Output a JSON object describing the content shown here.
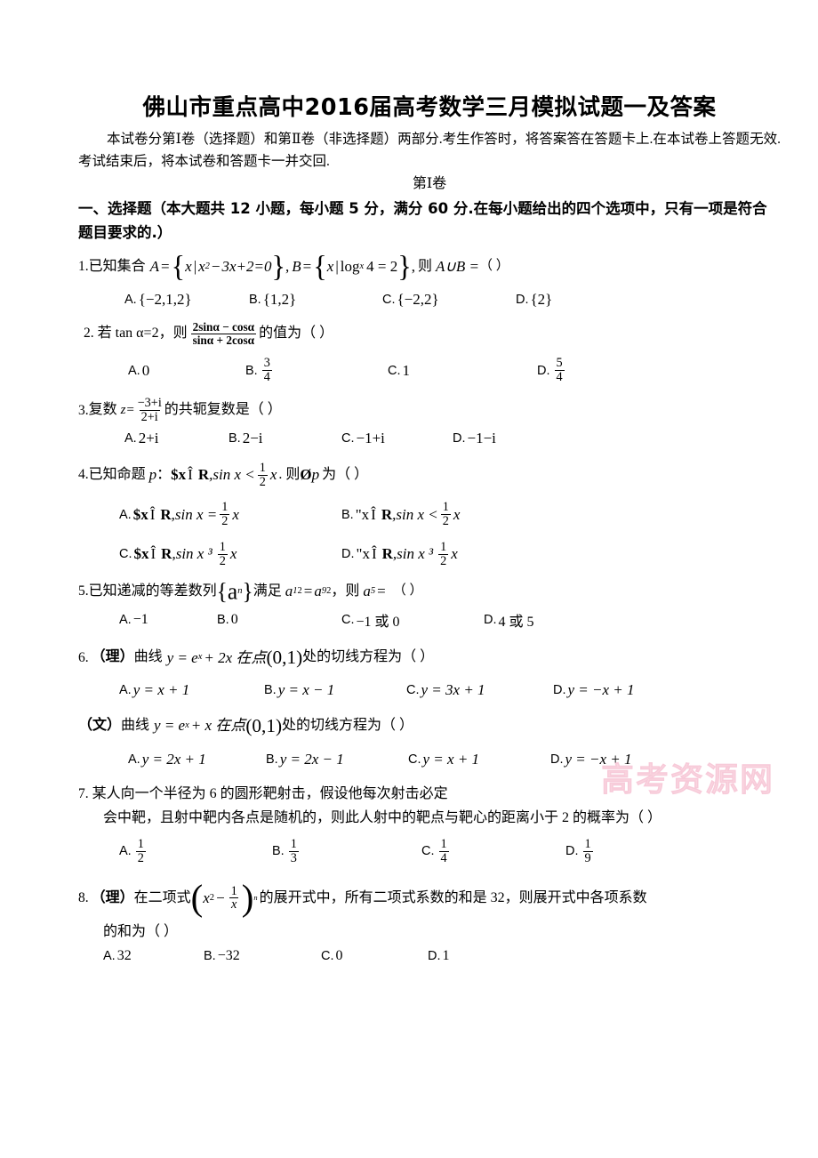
{
  "document": {
    "title": "佛山市重点高中2016届高考数学三月模拟试题一及答案",
    "intro": "本试卷分第Ⅰ卷（选择题）和第Ⅱ卷（非选择题）两部分.考生作答时，将答案答在答题卡上.在本试卷上答题无效.考试结束后，将本试卷和答题卡一并交回.",
    "volume_header": "第Ⅰ卷",
    "section_heading": "一、选择题（本大题共 12 小题，每小题 5 分，满分 60 分.在每小题给出的四个选项中，只有一项是符合题目要求的.）",
    "watermark": "高考资源网"
  },
  "questions": [
    {
      "number": "1.",
      "stem_prefix": "已知集合",
      "A_label": "A",
      "A_set_var": "x",
      "A_poly": "3x+2=0",
      "A_poly_lead": "x",
      "B_label": "B",
      "B_set_var": "x",
      "B_log": "log",
      "B_log_base": "x",
      "B_log_rest": "4 = 2",
      "then": "则",
      "union": "A∪B =",
      "paren": "（       ）",
      "options": [
        {
          "label": "A.",
          "value": "{−2,1,2}"
        },
        {
          "label": "B.",
          "value": "{1,2}"
        },
        {
          "label": "C.",
          "value": "{−2,2}"
        },
        {
          "label": "D.",
          "value": "{2}"
        }
      ]
    },
    {
      "number": "2.",
      "stem": "若 tan α=2，则",
      "frac_num": "2sinα − cosα",
      "frac_den": "sinα + 2cosα",
      "tail": "的值为（     ）",
      "options": [
        {
          "label": "A.",
          "value": "0"
        },
        {
          "label": "B.",
          "num": "3",
          "den": "4"
        },
        {
          "label": "C.",
          "value": "1"
        },
        {
          "label": "D.",
          "num": "5",
          "den": "4"
        }
      ]
    },
    {
      "number": "3.",
      "stem": "复数",
      "var": "z=",
      "frac_num": "−3+i",
      "frac_den": "2+i",
      "tail": "的共轭复数是（     ）",
      "options": [
        {
          "label": "A.",
          "value": "2+i"
        },
        {
          "label": "B.",
          "value": "2−i"
        },
        {
          "label": "C.",
          "value": "−1+i"
        },
        {
          "label": "D.",
          "value": "−1−i"
        }
      ]
    },
    {
      "number": "4.",
      "stem": "已知命题",
      "p": "p",
      "colon": "：",
      "exists": "$x",
      "isin": "Î",
      "setR": "R",
      "body": ",sin x <",
      "frac_num": "1",
      "frac_den": "2",
      "xvar": "x",
      "then": ". 则",
      "neg": "Ø",
      "p2": "p",
      "tail": "为（     ）",
      "options": [
        {
          "label": "A.",
          "quant": "$x",
          "isin": "Î",
          "setR": "R",
          "rel": ",sin x =",
          "num": "1",
          "den": "2",
          "xv": "x"
        },
        {
          "label": "B.",
          "quant": "\"x",
          "isin": "Î",
          "setR": "R",
          "rel": ",sin x <",
          "num": "1",
          "den": "2",
          "xv": "x"
        },
        {
          "label": "C.",
          "quant": "$x",
          "isin": "Î",
          "setR": "R",
          "rel": ",sin x ³",
          "num": "1",
          "den": "2",
          "xv": "x"
        },
        {
          "label": "D.",
          "quant": "\"x",
          "isin": "Î",
          "setR": "R",
          "rel": ",sin x ³",
          "num": "1",
          "den": "2",
          "xv": "x"
        }
      ]
    },
    {
      "number": "5.",
      "stem": "已知递减的等差数列",
      "seq": "{a",
      "seq_sub": "n",
      "seq_end": "}",
      "mid": "满足",
      "a1": "a",
      "a1sub": "1",
      "sq": "2",
      "eq": "=",
      "a9": "a",
      "a9sub": "9",
      "comma": "，则",
      "a5": "a",
      "a5sub": "5",
      "eqs": "=",
      "paren": "（     ）",
      "options": [
        {
          "label": "A.",
          "value": "−1"
        },
        {
          "label": "B.",
          "value": "0"
        },
        {
          "label": "C.",
          "value": "−1 或 0"
        },
        {
          "label": "D.",
          "value": "4 或 5"
        }
      ]
    },
    {
      "number": "6.",
      "variant_li": "（理）",
      "stem_li": "曲线",
      "eq_li": "y = e",
      "exp_li": "x",
      "eq_li2": "+ 2x 在点",
      "pt": "(0,1)",
      "tail_li": "处的切线方程为（     ）",
      "options_li": [
        {
          "label": "A.",
          "value": "y = x + 1"
        },
        {
          "label": "B.",
          "value": "y = x − 1"
        },
        {
          "label": "C.",
          "value": "y = 3x + 1"
        },
        {
          "label": "D.",
          "value": "y = −x + 1"
        }
      ],
      "variant_wen": "（文）",
      "stem_wen": "曲线",
      "eq_wen": "y = e",
      "exp_wen": "x",
      "eq_wen2": "+ x 在点",
      "tail_wen": "处的切线方程为（     ）",
      "options_wen": [
        {
          "label": "A.",
          "value": "y = 2x + 1"
        },
        {
          "label": "B.",
          "value": "y = 2x − 1"
        },
        {
          "label": "C.",
          "value": "y = x + 1"
        },
        {
          "label": "D.",
          "value": "y = −x + 1"
        }
      ]
    },
    {
      "number": "7.",
      "line1": "某人向一个半径为 6 的圆形靶射击，假设他每次射击必定",
      "line2": "会中靶，且射中靶内各点是随机的，则此人射中的靶点与靶心的距离小于 2 的概率为（     ）",
      "options": [
        {
          "label": "A.",
          "num": "1",
          "den": "2"
        },
        {
          "label": "B.",
          "num": "1",
          "den": "3"
        },
        {
          "label": "C.",
          "num": "1",
          "den": "4"
        },
        {
          "label": "D.",
          "num": "1",
          "den": "9"
        }
      ]
    },
    {
      "number": "8.",
      "variant": "（理）",
      "stem": "在二项式",
      "base_x": "x",
      "base_sup": "2",
      "minus": "−",
      "frac_num": "1",
      "frac_den": "x",
      "exp_n": "n",
      "mid": "的展开式中，所有二项式系数的和是 32，则展开式中各项系数",
      "line2": "的和为（     ）",
      "options": [
        {
          "label": "A.",
          "value": "32"
        },
        {
          "label": "B.",
          "value": "−32"
        },
        {
          "label": "C.",
          "value": "0"
        },
        {
          "label": "D.",
          "value": "1"
        }
      ]
    }
  ]
}
